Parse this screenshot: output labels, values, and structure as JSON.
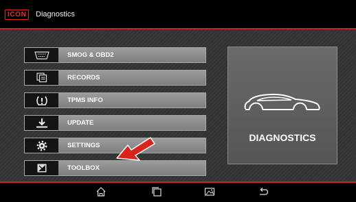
{
  "header": {
    "brand": "ICON",
    "title": "Diagnostics"
  },
  "menu": [
    {
      "label": "SMOG & OBD2",
      "icon": "obd-connector-icon"
    },
    {
      "label": "RECORDS",
      "icon": "records-icon"
    },
    {
      "label": "TPMS INFO",
      "icon": "tpms-icon"
    },
    {
      "label": "UPDATE",
      "icon": "download-icon"
    },
    {
      "label": "SETTINGS",
      "icon": "gear-icon"
    },
    {
      "label": "TOOLBOX",
      "icon": "toolbox-icon"
    }
  ],
  "diagnostics_tile": {
    "label": "DIAGNOSTICS",
    "icon": "car-outline-icon"
  },
  "navbar": [
    "home-icon",
    "recent-apps-icon",
    "screenshot-icon",
    "back-icon"
  ],
  "colors": {
    "accent": "#c9241d",
    "button": "#8c8c8c",
    "tile": "#606060",
    "background": "#333333"
  }
}
